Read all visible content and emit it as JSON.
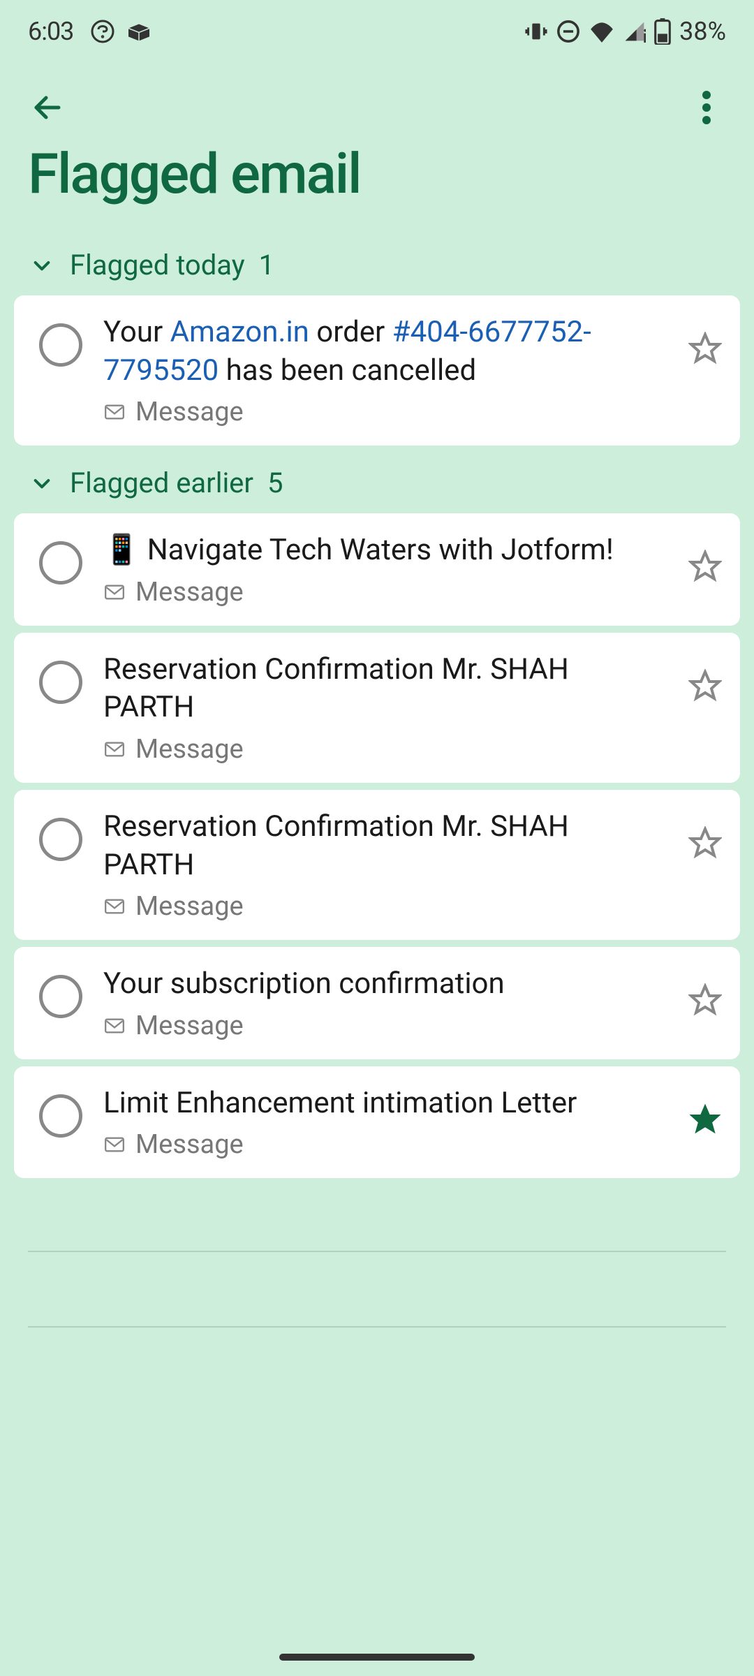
{
  "statusBar": {
    "time": "6:03",
    "battery": "38%"
  },
  "page": {
    "title": "Flagged email"
  },
  "groups": [
    {
      "label": "Flagged today",
      "count": "1",
      "tasks": [
        {
          "title_prefix": "Your ",
          "link1": "Amazon.in",
          "title_mid": " order ",
          "link2": "#404-6677752-7795520",
          "title_suffix": " has been cancelled",
          "meta": "Message",
          "starred": false
        }
      ]
    },
    {
      "label": "Flagged earlier",
      "count": "5",
      "tasks": [
        {
          "title": "📱 Navigate Tech Waters with Jotform!",
          "meta": "Message",
          "starred": false
        },
        {
          "title": "Reservation Confirmation  Mr. SHAH PARTH",
          "meta": "Message",
          "starred": false
        },
        {
          "title": "Reservation Confirmation Mr. SHAH PARTH",
          "meta": "Message",
          "starred": false
        },
        {
          "title": "Your subscription confirmation",
          "meta": "Message",
          "starred": false
        },
        {
          "title": "Limit Enhancement intimation Letter",
          "meta": "Message",
          "starred": true
        }
      ]
    }
  ]
}
